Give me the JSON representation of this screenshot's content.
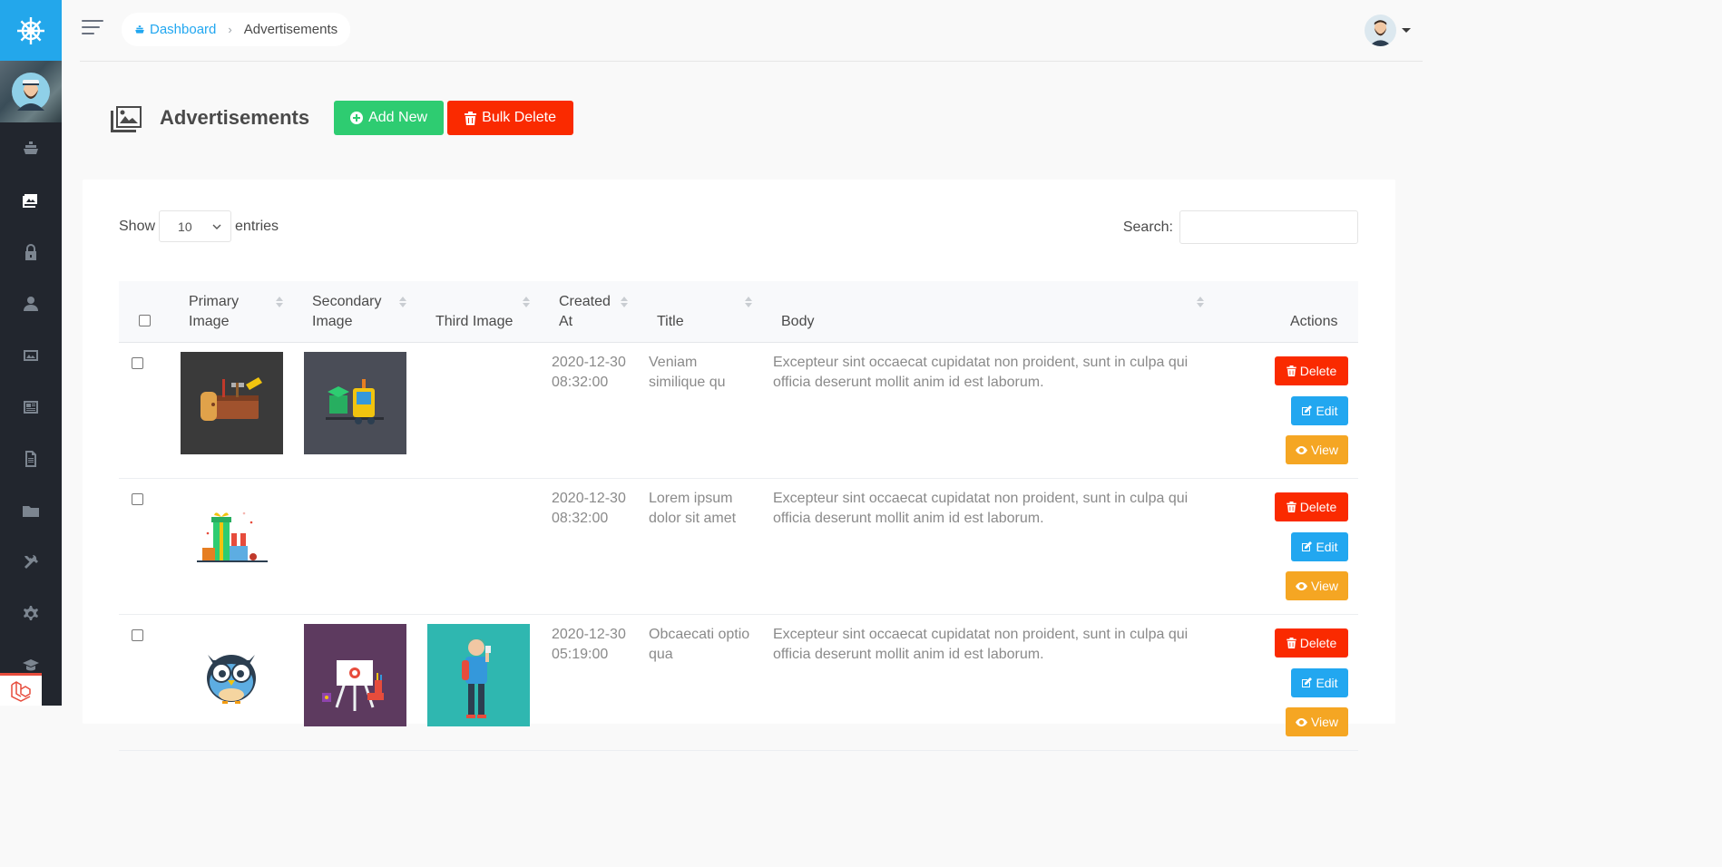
{
  "breadcrumb": {
    "home": "Dashboard",
    "current": "Advertisements"
  },
  "page": {
    "title": "Advertisements",
    "add_label": "Add New",
    "bulk_delete_label": "Bulk Delete"
  },
  "table_controls": {
    "show_label": "Show",
    "entries_value": "10",
    "entries_label": "entries",
    "search_label": "Search:",
    "search_value": ""
  },
  "columns": {
    "primary_1": "Primary",
    "primary_2": "Image",
    "secondary_1": "Secondary",
    "secondary_2": "Image",
    "third": "Third Image",
    "created_1": "Created",
    "created_2": "At",
    "title": "Title",
    "body": "Body",
    "actions": "Actions"
  },
  "rows": [
    {
      "created_date": "2020-12-30",
      "created_time": "08:32:00",
      "title_1": "Veniam",
      "title_2": "similique qu",
      "body_1": "Excepteur sint occaecat cupidatat non proident, sunt in culpa qui",
      "body_2": "officia deserunt mollit anim id est laborum.",
      "primary_image": "toolbox-illustration",
      "secondary_image": "delivery-truck-illustration",
      "third_image": ""
    },
    {
      "created_date": "2020-12-30",
      "created_time": "08:32:00",
      "title_1": "Lorem ipsum",
      "title_2": "dolor sit amet",
      "body_1": "Excepteur sint occaecat cupidatat non proident, sunt in culpa qui",
      "body_2": "officia deserunt mollit anim id est laborum.",
      "primary_image": "gift-boxes-illustration",
      "secondary_image": "",
      "third_image": ""
    },
    {
      "created_date": "2020-12-30",
      "created_time": "05:19:00",
      "title_1": "Obcaecati optio",
      "title_2": "qua",
      "body_1": "Excepteur sint occaecat cupidatat non proident, sunt in culpa qui",
      "body_2": "officia deserunt mollit anim id est laborum.",
      "primary_image": "owl-illustration",
      "secondary_image": "easel-illustration",
      "third_image": "person-illustration"
    }
  ],
  "actions": {
    "delete": "Delete",
    "edit": "Edit",
    "view": "View"
  },
  "sidebar": {
    "items": [
      {
        "icon": "ship-icon"
      },
      {
        "icon": "images-icon",
        "active": true
      },
      {
        "icon": "lock-icon"
      },
      {
        "icon": "user-icon"
      },
      {
        "icon": "picture-icon"
      },
      {
        "icon": "news-icon"
      },
      {
        "icon": "document-icon"
      },
      {
        "icon": "folder-icon"
      },
      {
        "icon": "tools-icon"
      },
      {
        "icon": "settings-icon"
      },
      {
        "icon": "graduation-icon"
      }
    ]
  },
  "colors": {
    "sidebar": "#22262e",
    "brand": "#23a7eb",
    "success": "#2ecc71",
    "danger": "#fa2a00",
    "info": "#22a7f0",
    "warning": "#f5a623"
  }
}
